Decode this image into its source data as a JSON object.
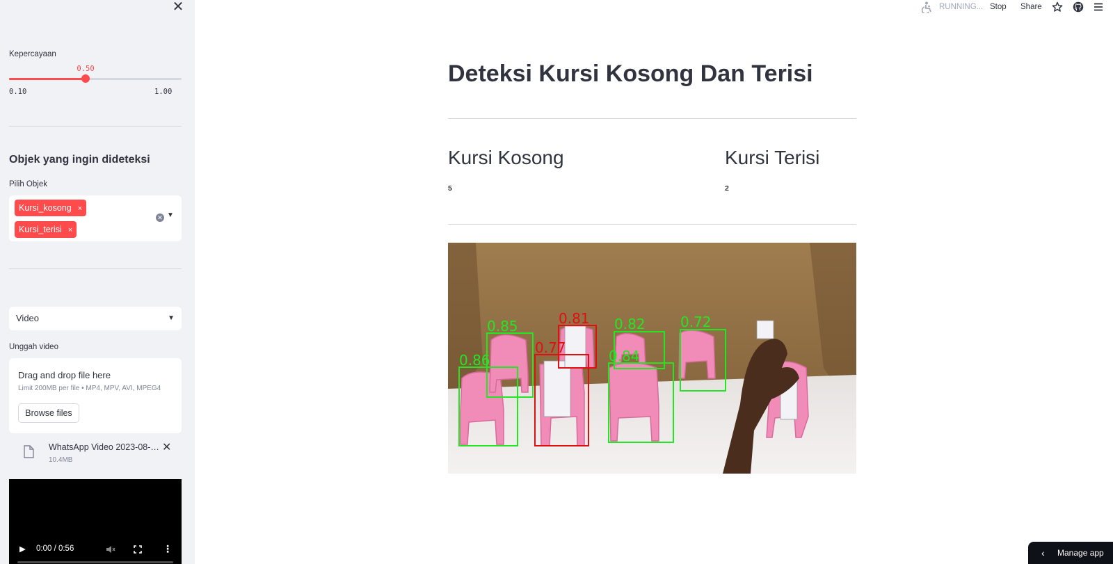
{
  "sidebar": {
    "close_icon": "close-icon",
    "confidence": {
      "label": "Kepercayaan",
      "value": "0.50",
      "min": "0.10",
      "max": "1.00",
      "level": 0.444
    },
    "objects_heading": "Objek yang ingin dideteksi",
    "objects_select": {
      "label": "Pilih Objek",
      "tags": [
        {
          "label": "Kursi_kosong",
          "remove": "×"
        },
        {
          "label": "Kursi_terisi",
          "remove": "×"
        }
      ]
    },
    "source_select": {
      "value": "Video"
    },
    "uploader": {
      "label": "Unggah video",
      "title": "Drag and drop file here",
      "limit": "Limit 200MB per file • MP4, MPV, AVI, MPEG4",
      "button": "Browse files",
      "file_name": "WhatsApp Video 2023-08-2...",
      "file_size": "10.4MB"
    },
    "video_player": {
      "time": "0:00 / 0:56"
    }
  },
  "topbar": {
    "status": "RUNNING...",
    "stop": "Stop",
    "share": "Share"
  },
  "main": {
    "title": "Deteksi Kursi Kosong Dan Terisi",
    "col_empty": {
      "title": "Kursi Kosong",
      "value": "5"
    },
    "col_filled": {
      "title": "Kursi Terisi",
      "value": "2"
    },
    "detections": [
      {
        "label": "0.86",
        "status": "kosong"
      },
      {
        "label": "0.85",
        "status": "kosong"
      },
      {
        "label": "0.77",
        "status": "terisi"
      },
      {
        "label": "0.81",
        "status": "terisi"
      },
      {
        "label": "0.82",
        "status": "kosong"
      },
      {
        "label": "0.84",
        "status": "kosong"
      },
      {
        "label": "0.72",
        "status": "kosong"
      }
    ]
  },
  "manage_app": "Manage app",
  "colors": {
    "accent": "#ff4b4b",
    "empty_box": "#22e622",
    "filled_box": "#e01010"
  }
}
